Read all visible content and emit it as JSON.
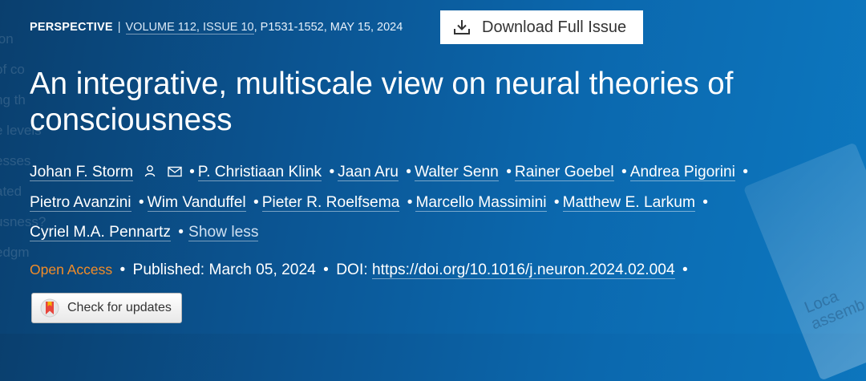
{
  "background_ghost": [
    "ion",
    "of co",
    "ng th",
    "e levels",
    "esses",
    "ated",
    "usness?",
    "edgm"
  ],
  "corner_ghost": [
    "Loca",
    "assemb"
  ],
  "meta": {
    "type": "PERSPECTIVE",
    "separator": "|",
    "volume_issue": "VOLUME 112, ISSUE 10",
    "pages_date": ", P1531-1552, MAY 15, 2024"
  },
  "download_button": {
    "label": "Download Full Issue",
    "icon": "download-icon"
  },
  "title": "An integrative, multiscale view on neural theories of consciousness",
  "authors": [
    "Johan F. Storm",
    "P. Christiaan Klink",
    "Jaan Aru",
    "Walter Senn",
    "Rainer Goebel",
    "Andrea Pigorini",
    "Pietro Avanzini",
    "Wim Vanduffel",
    "Pieter R. Roelfsema",
    "Marcello Massimini",
    "Matthew E. Larkum",
    "Cyriel M.A. Pennartz"
  ],
  "author_icons": [
    "person-icon",
    "mail-icon"
  ],
  "bullet": "•",
  "show_less": "Show less",
  "publication": {
    "open_access": "Open Access",
    "published": "Published: March 05, 2024",
    "doi_label": "DOI:",
    "doi_link": "https://doi.org/10.1016/j.neuron.2024.02.004"
  },
  "check_updates": {
    "label": "Check for updates",
    "icon": "bookmark-icon"
  },
  "colors": {
    "accent_orange": "#f28c28",
    "bg_dark": "#0a3f6e",
    "bg_light": "#0d78c0"
  }
}
